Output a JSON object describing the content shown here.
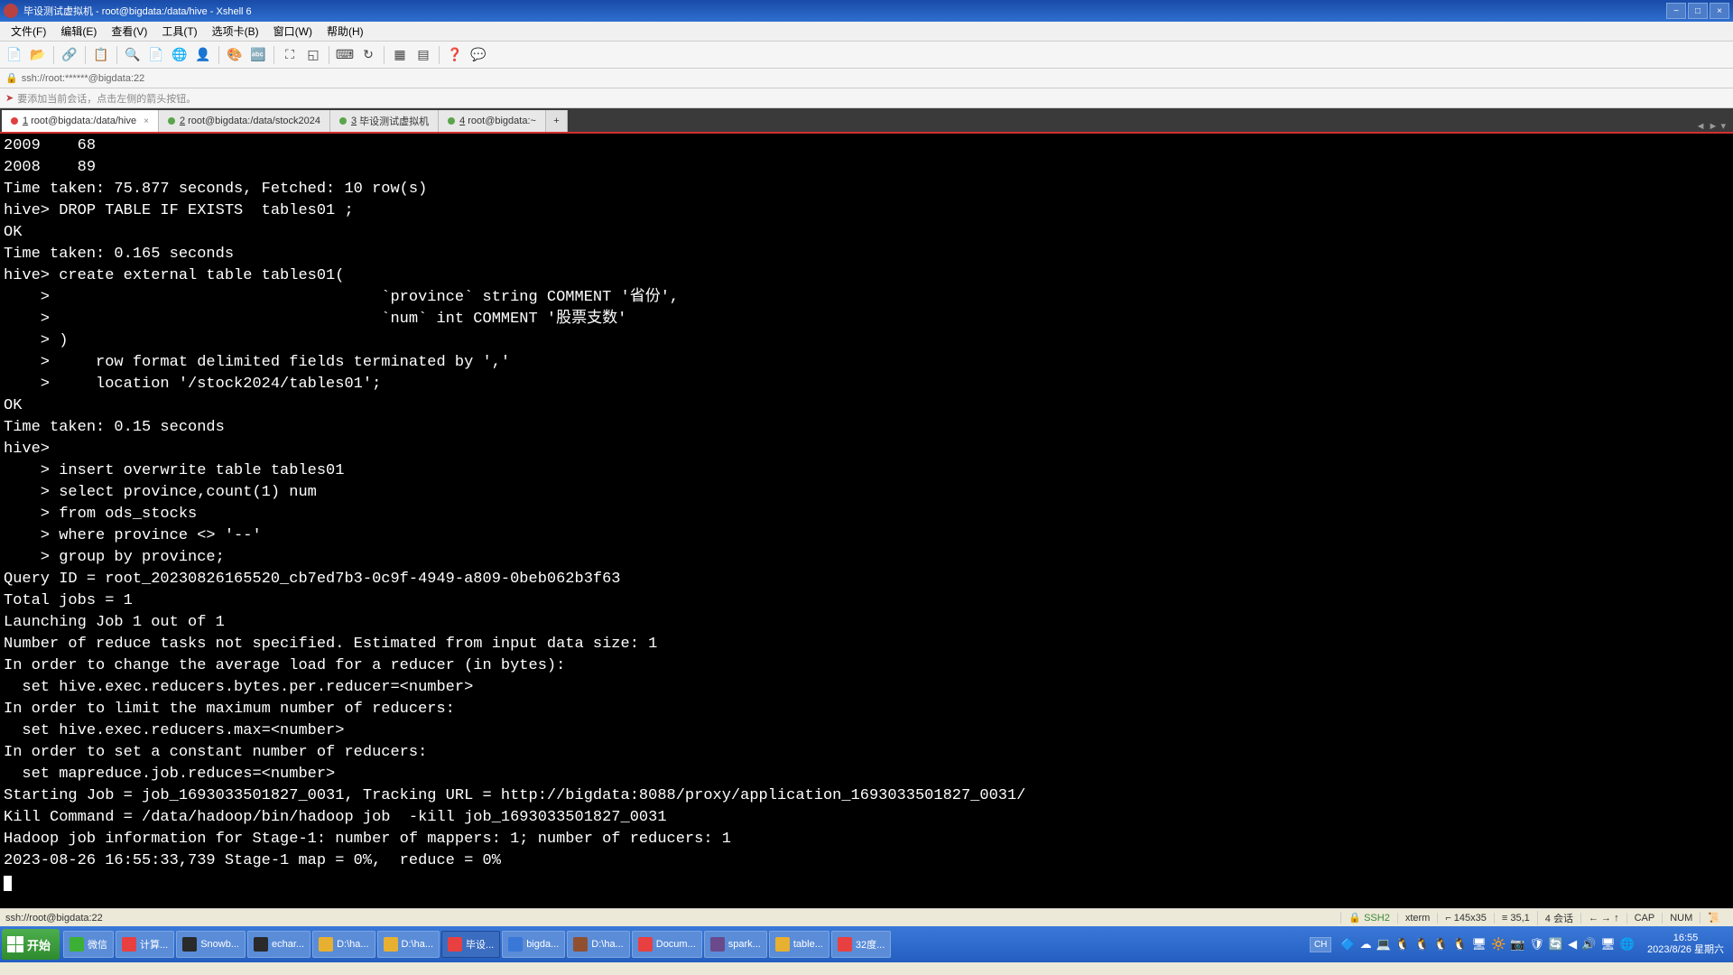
{
  "title": "毕设测试虚拟机 - root@bigdata:/data/hive - Xshell 6",
  "menu": [
    "文件(F)",
    "编辑(E)",
    "查看(V)",
    "工具(T)",
    "选项卡(B)",
    "窗口(W)",
    "帮助(H)"
  ],
  "address": "ssh://root:******@bigdata:22",
  "hint": "要添加当前会话，点击左侧的箭头按钮。",
  "tabs": [
    {
      "num": "1",
      "label": "root@bigdata:/data/hive",
      "dot": "red",
      "active": true,
      "close": true
    },
    {
      "num": "2",
      "label": "root@bigdata:/data/stock2024",
      "dot": "green"
    },
    {
      "num": "3",
      "label": "毕设测试虚拟机",
      "dot": "green"
    },
    {
      "num": "4",
      "label": "root@bigdata:~",
      "dot": "green"
    }
  ],
  "terminal_lines": [
    "2009    68",
    "2008    89",
    "Time taken: 75.877 seconds, Fetched: 10 row(s)",
    "hive> DROP TABLE IF EXISTS  tables01 ;",
    "OK",
    "Time taken: 0.165 seconds",
    "hive> create external table tables01(",
    "    >                                    `province` string COMMENT '省份',",
    "    >                                    `num` int COMMENT '股票支数'",
    "    > )",
    "    >     row format delimited fields terminated by ','",
    "    >     location '/stock2024/tables01';",
    "OK",
    "Time taken: 0.15 seconds",
    "hive>",
    "    > insert overwrite table tables01",
    "    > select province,count(1) num",
    "    > from ods_stocks",
    "    > where province <> '--'",
    "    > group by province;",
    "Query ID = root_20230826165520_cb7ed7b3-0c9f-4949-a809-0beb062b3f63",
    "Total jobs = 1",
    "Launching Job 1 out of 1",
    "Number of reduce tasks not specified. Estimated from input data size: 1",
    "In order to change the average load for a reducer (in bytes):",
    "  set hive.exec.reducers.bytes.per.reducer=<number>",
    "In order to limit the maximum number of reducers:",
    "  set hive.exec.reducers.max=<number>",
    "In order to set a constant number of reducers:",
    "  set mapreduce.job.reduces=<number>",
    "Starting Job = job_1693033501827_0031, Tracking URL = http://bigdata:8088/proxy/application_1693033501827_0031/",
    "Kill Command = /data/hadoop/bin/hadoop job  -kill job_1693033501827_0031",
    "Hadoop job information for Stage-1: number of mappers: 1; number of reducers: 1",
    "2023-08-26 16:55:33,739 Stage-1 map = 0%,  reduce = 0%"
  ],
  "status": {
    "left": "ssh://root@bigdata:22",
    "ssh": "SSH2",
    "term": "xterm",
    "size": "⌐ 145x35",
    "pos": "≡ 35,1",
    "sessions": "4 会话",
    "extra": "← → ↑",
    "cap": "CAP",
    "num": "NUM"
  },
  "taskbar": {
    "start": "开始",
    "items": [
      {
        "label": "微信",
        "color": "#3cb034"
      },
      {
        "label": "计算...",
        "color": "#e84040"
      },
      {
        "label": "Snowb...",
        "color": "#2a2a2a"
      },
      {
        "label": "echar...",
        "color": "#2a2a2a"
      },
      {
        "label": "D:\\ha...",
        "color": "#e8b030"
      },
      {
        "label": "D:\\ha...",
        "color": "#e8b030"
      },
      {
        "label": "毕设...",
        "color": "#e84040",
        "active": true
      },
      {
        "label": "bigda...",
        "color": "#3a78d8"
      },
      {
        "label": "D:\\ha...",
        "color": "#905030"
      },
      {
        "label": "Docum...",
        "color": "#e84040"
      },
      {
        "label": "spark...",
        "color": "#6a4a8a"
      },
      {
        "label": "table...",
        "color": "#e8b030"
      },
      {
        "label": "32度...",
        "color": "#e84040"
      }
    ],
    "lang": "CH",
    "clock_time": "16:55",
    "clock_date": "2023/8/26 星期六"
  }
}
